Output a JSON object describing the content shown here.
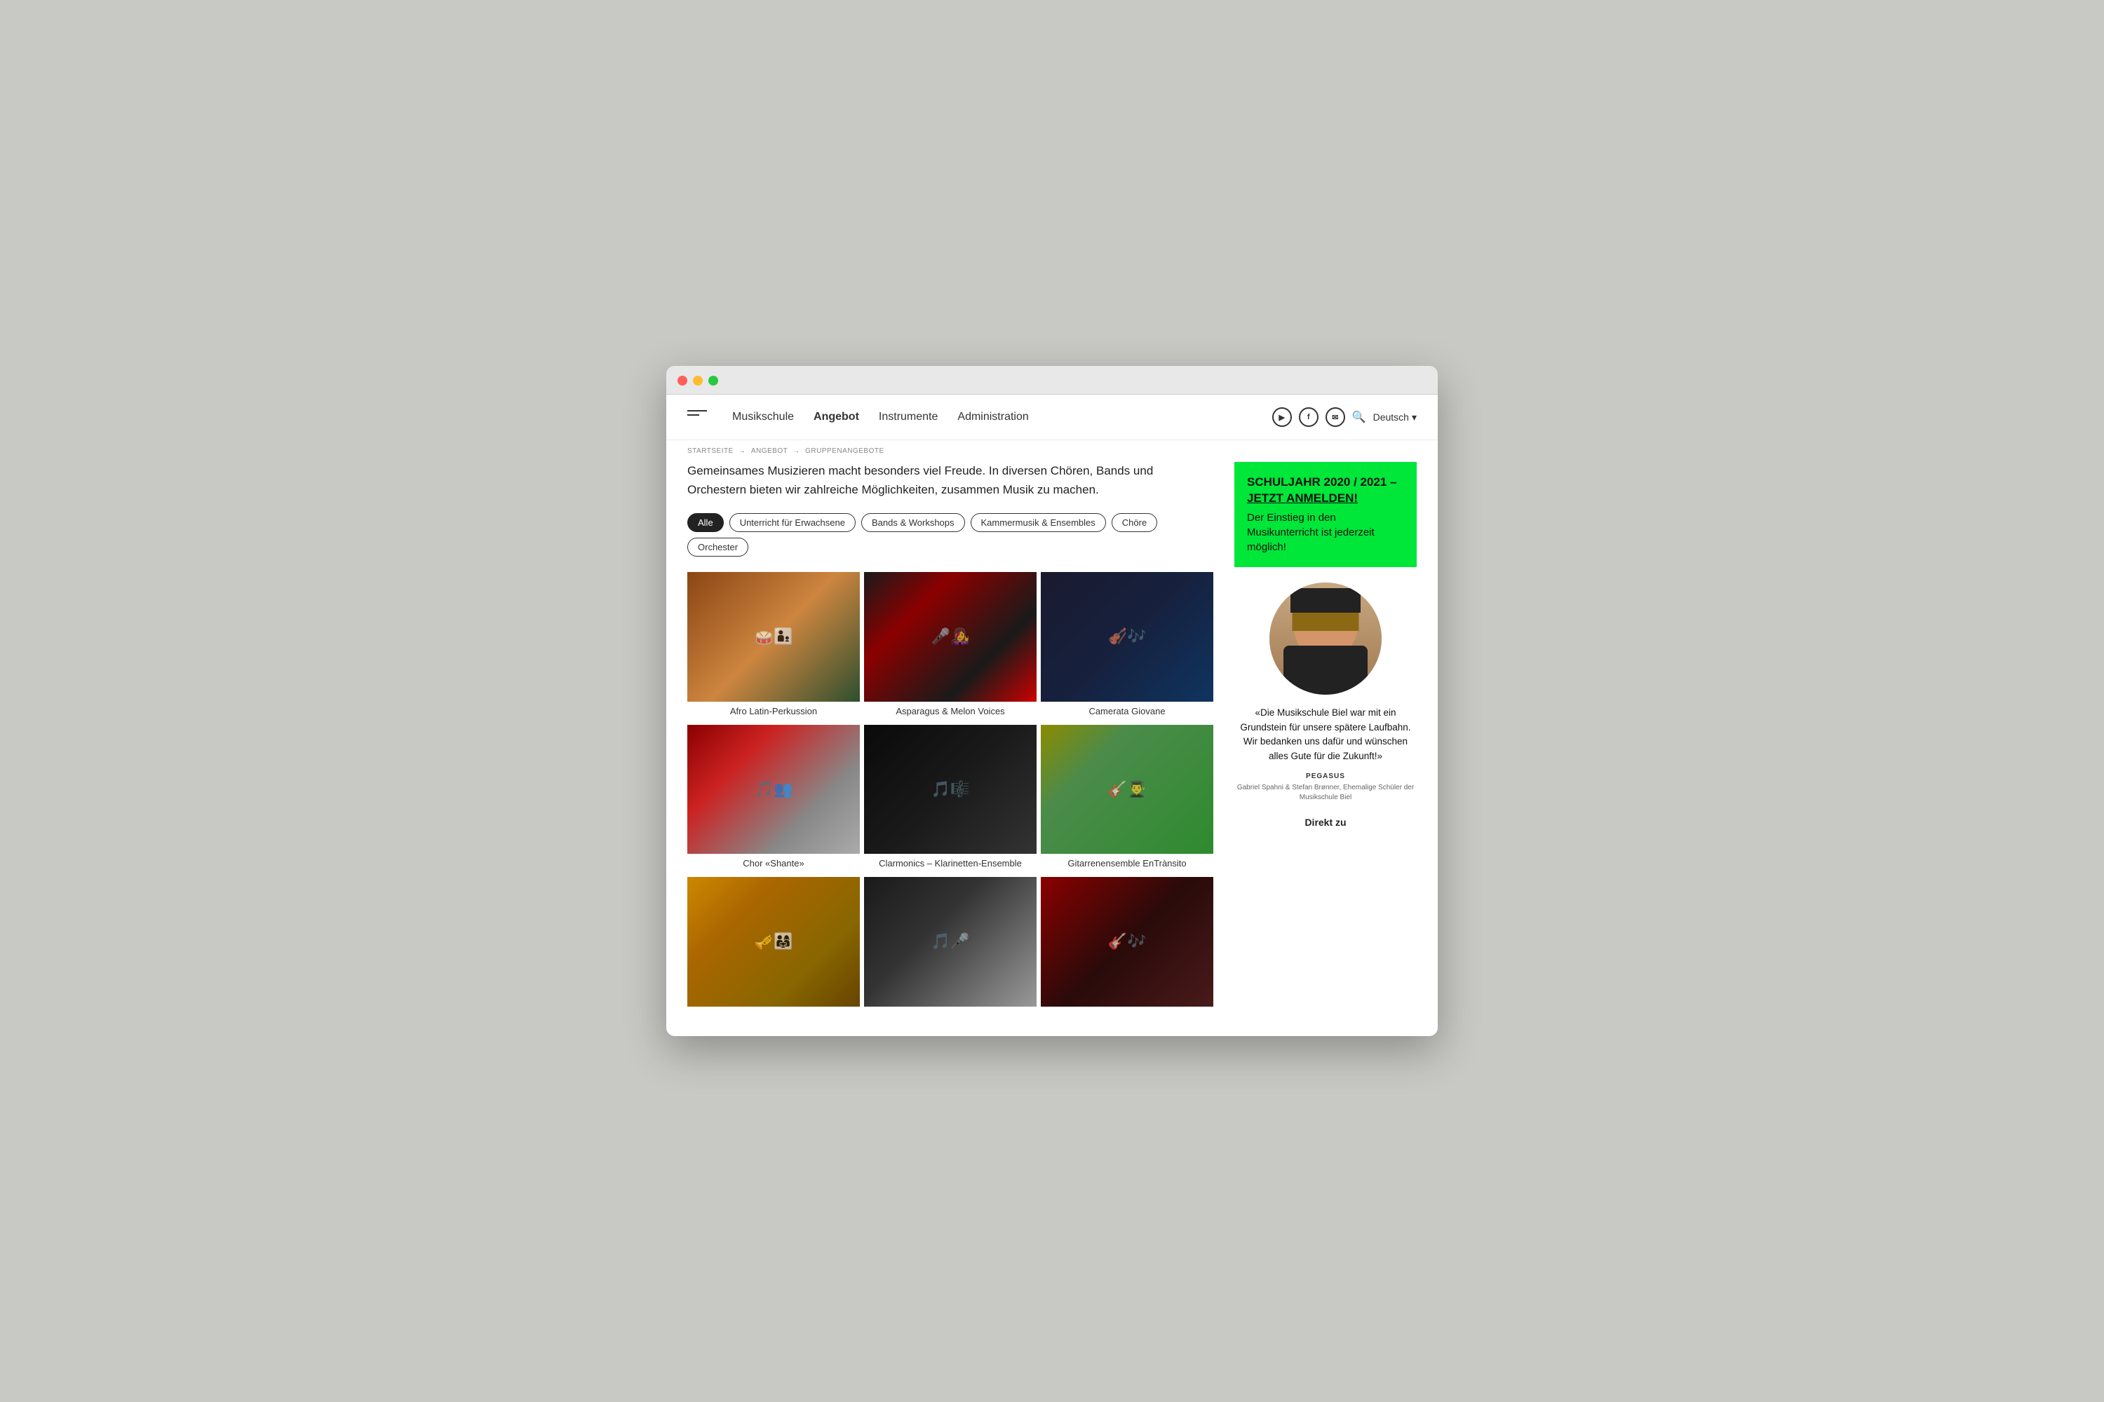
{
  "browser": {
    "traffic_lights": [
      "red",
      "yellow",
      "green"
    ]
  },
  "header": {
    "logo_alt": "Musikschule Biel",
    "nav": [
      {
        "label": "Musikschule",
        "active": false
      },
      {
        "label": "Angebot",
        "active": true
      },
      {
        "label": "Instrumente",
        "active": false
      },
      {
        "label": "Administration",
        "active": false
      }
    ],
    "social": [
      {
        "icon": "▶",
        "name": "youtube"
      },
      {
        "icon": "f",
        "name": "facebook"
      },
      {
        "icon": "✉",
        "name": "email"
      }
    ],
    "search_label": "🔍",
    "language": "Deutsch",
    "language_arrow": "▾"
  },
  "breadcrumb": {
    "items": [
      "STARTSEITE",
      "ANGEBOT",
      "GRUPPENANGEBOTE"
    ],
    "arrows": [
      "→",
      "→"
    ]
  },
  "content": {
    "intro": "Gemeinsames Musizieren macht besonders viel Freude. In diversen Chören, Bands und Orchestern bieten wir zahlreiche Möglichkeiten, zusammen Musik zu machen.",
    "filters": [
      {
        "label": "Alle",
        "active": true
      },
      {
        "label": "Unterricht für Erwachsene",
        "active": false
      },
      {
        "label": "Bands & Workshops",
        "active": false
      },
      {
        "label": "Kammermusik & Ensembles",
        "active": false
      },
      {
        "label": "Chöre",
        "active": false
      },
      {
        "label": "Orchester",
        "active": false
      }
    ],
    "grid_items": [
      {
        "title": "Afro Latin-Perkussion",
        "img_class": "img-afro"
      },
      {
        "title": "Asparagus & Melon Voices",
        "img_class": "img-asparagus"
      },
      {
        "title": "Camerata Giovane",
        "img_class": "img-camerata"
      },
      {
        "title": "Chor «Shante»",
        "img_class": "img-chor"
      },
      {
        "title": "Clarmonics – Klarinetten-Ensemble",
        "img_class": "img-clarmonics"
      },
      {
        "title": "Gitarrenensemble EnTrànsito",
        "img_class": "img-gitarren"
      },
      {
        "title": "",
        "img_class": "img-row3a"
      },
      {
        "title": "",
        "img_class": "img-row3b"
      },
      {
        "title": "",
        "img_class": "img-row3c"
      }
    ]
  },
  "sidebar": {
    "promo_title": "SCHULJAHR 2020 / 2021 –",
    "promo_cta": "JETZT ANMELDEN!",
    "promo_body": "Der Einstieg in den Musikunterricht ist jederzeit möglich!",
    "quote": "«Die Musikschule Biel war mit ein Grundstein für unsere spätere Laufbahn. Wir bedanken uns dafür und wünschen alles Gute für die Zukunft!»",
    "quote_author": "PEGASUS",
    "quote_sub": "Gabriel Spahni & Stefan Brønner, Ehemalige Schüler der Musikschule Biel",
    "direkt_zu": "Direkt zu"
  }
}
